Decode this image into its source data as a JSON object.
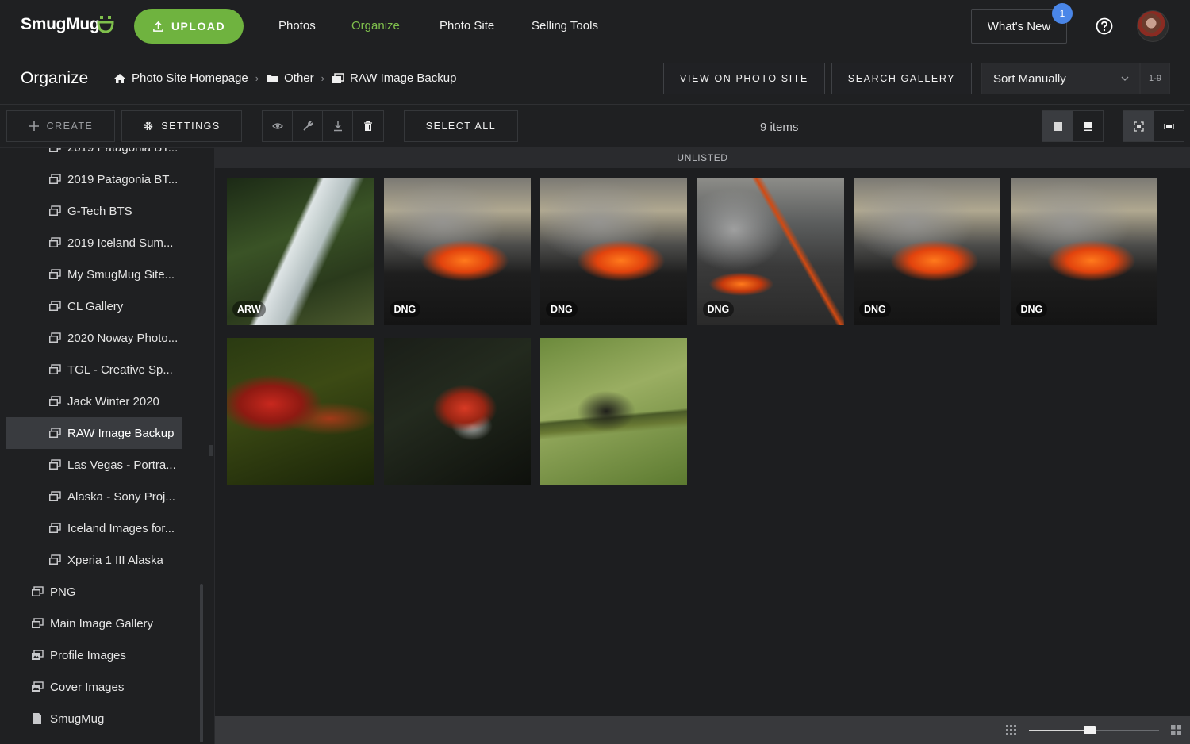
{
  "header": {
    "logo": "SmugMug",
    "upload_label": "UPLOAD",
    "nav": [
      {
        "label": "Photos"
      },
      {
        "label": "Organize"
      },
      {
        "label": "Photo Site"
      },
      {
        "label": "Selling Tools"
      }
    ],
    "whats_new_label": "What's New",
    "whats_new_badge": "1"
  },
  "subheader": {
    "title": "Organize",
    "breadcrumb": [
      {
        "label": "Photo Site Homepage",
        "icon": "home-icon"
      },
      {
        "label": "Other",
        "icon": "folder-icon"
      },
      {
        "label": "RAW Image Backup",
        "icon": "gallery-icon"
      }
    ],
    "view_on_photo_site_label": "VIEW ON PHOTO SITE",
    "search_gallery_label": "SEARCH GALLERY",
    "sort_value": "Sort Manually",
    "range_label": "1-9"
  },
  "toolbar": {
    "create_label": "CREATE",
    "settings_label": "SETTINGS",
    "select_all_label": "SELECT ALL",
    "items_count": "9 items"
  },
  "sidebar": {
    "items": [
      {
        "label": "2019 Patagonia BT..."
      },
      {
        "label": "2019 Patagonia BT..."
      },
      {
        "label": "G-Tech BTS"
      },
      {
        "label": "2019 Iceland Sum..."
      },
      {
        "label": "My SmugMug Site..."
      },
      {
        "label": "CL Gallery"
      },
      {
        "label": "2020 Noway Photo..."
      },
      {
        "label": "TGL - Creative Sp..."
      },
      {
        "label": "Jack Winter 2020"
      },
      {
        "label": "RAW Image Backup"
      },
      {
        "label": "Las Vegas - Portra..."
      },
      {
        "label": "Alaska - Sony Proj..."
      },
      {
        "label": "Iceland Images for..."
      },
      {
        "label": "Xperia 1 III Alaska"
      },
      {
        "label": "PNG"
      },
      {
        "label": "Main Image Gallery"
      },
      {
        "label": "Profile Images"
      },
      {
        "label": "Cover Images"
      },
      {
        "label": "SmugMug"
      }
    ]
  },
  "main": {
    "section_label": "UNLISTED",
    "photos": [
      {
        "type": "ARW",
        "subject": "waterfall"
      },
      {
        "type": "DNG",
        "subject": "volcano"
      },
      {
        "type": "DNG",
        "subject": "volcano"
      },
      {
        "type": "DNG",
        "subject": "lava-field"
      },
      {
        "type": "DNG",
        "subject": "volcano"
      },
      {
        "type": "DNG",
        "subject": "volcano"
      },
      {
        "type": "",
        "subject": "macaw"
      },
      {
        "type": "",
        "subject": "frog"
      },
      {
        "type": "",
        "subject": "quetzal"
      }
    ]
  },
  "colors": {
    "accent_green": "#6fb33f",
    "badge_blue": "#4a86e8"
  }
}
